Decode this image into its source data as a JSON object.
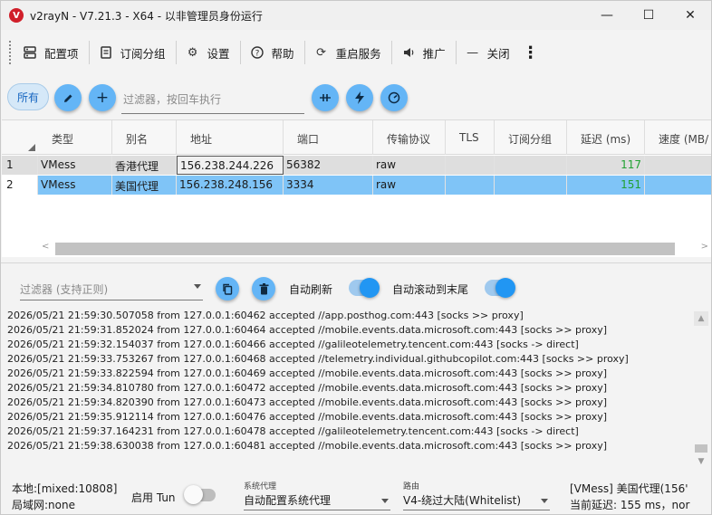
{
  "window": {
    "title": "v2rayN - V7.21.3 - X64 - 以非管理员身份运行",
    "minimize_glyph": "—",
    "maximize_glyph": "☐",
    "close_glyph": "✕"
  },
  "toolbar": {
    "items": [
      {
        "label": "配置项",
        "icon": "server-icon"
      },
      {
        "label": "订阅分组",
        "icon": "subscription-icon"
      },
      {
        "label": "设置",
        "icon": "gear-icon"
      },
      {
        "label": "帮助",
        "icon": "help-icon"
      },
      {
        "label": "重启服务",
        "icon": "restart-icon"
      },
      {
        "label": "推广",
        "icon": "speaker-icon"
      },
      {
        "label": "关闭",
        "icon": "minus-icon"
      }
    ],
    "more_glyph": "⋮"
  },
  "filterbar": {
    "all_label": "所有",
    "filter_placeholder": "过滤器，按回车执行"
  },
  "table": {
    "columns": [
      "类型",
      "别名",
      "地址",
      "端口",
      "传输协议",
      "TLS",
      "订阅分组",
      "延迟 (ms)",
      "速度 (MB/"
    ],
    "rows": [
      {
        "index": "1",
        "type": "VMess",
        "alias": "香港代理",
        "address": "156.238.244.226",
        "port": "56382",
        "transport": "raw",
        "tls": "",
        "subgroup": "",
        "delay": "117",
        "speed": ""
      },
      {
        "index": "2",
        "type": "VMess",
        "alias": "美国代理",
        "address": "156.238.248.156",
        "port": "3334",
        "transport": "raw",
        "tls": "",
        "subgroup": "",
        "delay": "151",
        "speed": ""
      }
    ],
    "selected_row": 2,
    "delay_color": "#21a132",
    "selected_color": "#7fc4f7"
  },
  "logpanel": {
    "filter_placeholder": "过滤器 (支持正则)",
    "auto_refresh_label": "自动刷新",
    "auto_scroll_label": "自动滚动到末尾",
    "auto_refresh_on": true,
    "auto_scroll_on": true,
    "lines": [
      "2026/05/21 21:59:30.507058 from 127.0.0.1:60462 accepted //app.posthog.com:443 [socks >> proxy]",
      "2026/05/21 21:59:31.852024 from 127.0.0.1:60464 accepted //mobile.events.data.microsoft.com:443 [socks >> proxy]",
      "2026/05/21 21:59:32.154037 from 127.0.0.1:60466 accepted //galileotelemetry.tencent.com:443 [socks -> direct]",
      "2026/05/21 21:59:33.753267 from 127.0.0.1:60468 accepted //telemetry.individual.githubcopilot.com:443 [socks >> proxy]",
      "2026/05/21 21:59:33.822594 from 127.0.0.1:60469 accepted //mobile.events.data.microsoft.com:443 [socks >> proxy]",
      "2026/05/21 21:59:34.810780 from 127.0.0.1:60472 accepted //mobile.events.data.microsoft.com:443 [socks >> proxy]",
      "2026/05/21 21:59:34.820390 from 127.0.0.1:60473 accepted //mobile.events.data.microsoft.com:443 [socks >> proxy]",
      "2026/05/21 21:59:35.912114 from 127.0.0.1:60476 accepted //mobile.events.data.microsoft.com:443 [socks >> proxy]",
      "2026/05/21 21:59:37.164231 from 127.0.0.1:60478 accepted //galileotelemetry.tencent.com:443 [socks -> direct]",
      "2026/05/21 21:59:38.630038 from 127.0.0.1:60481 accepted //mobile.events.data.microsoft.com:443 [socks >> proxy]"
    ]
  },
  "statusbar": {
    "local": "本地:[mixed:10808]",
    "lan": "局域网:none",
    "tun_label": "启用 Tun",
    "tun_on": false,
    "sysproxy_caption": "系统代理",
    "sysproxy_value": "自动配置系统代理",
    "routing_caption": "路由",
    "routing_value": "V4-绕过大陆(Whitelist)",
    "current_server": "[VMess] 美国代理(156'",
    "current_delay": "当前延迟: 155 ms，nor"
  }
}
